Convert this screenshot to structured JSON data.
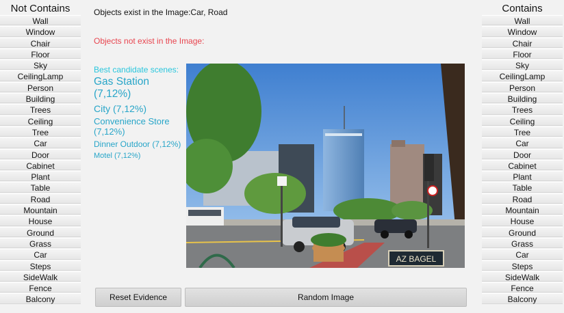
{
  "left_panel": {
    "title": "Not Contains",
    "items": [
      "Wall",
      "Window",
      "Chair",
      "Floor",
      "Sky",
      "CeilingLamp",
      "Person",
      "Building",
      "Trees",
      "Ceiling",
      "Tree",
      "Car",
      "Door",
      "Cabinet",
      "Plant",
      "Table",
      "Road",
      "Mountain",
      "House",
      "Ground",
      "Grass",
      "Car",
      "Steps",
      "SideWalk",
      "Fence",
      "Balcony"
    ]
  },
  "right_panel": {
    "title": "Contains",
    "items": [
      "Wall",
      "Window",
      "Chair",
      "Floor",
      "Sky",
      "CeilingLamp",
      "Person",
      "Building",
      "Trees",
      "Ceiling",
      "Tree",
      "Car",
      "Door",
      "Cabinet",
      "Plant",
      "Table",
      "Road",
      "Mountain",
      "House",
      "Ground",
      "Grass",
      "Car",
      "Steps",
      "SideWalk",
      "Fence",
      "Balcony"
    ]
  },
  "status": {
    "exist": "Objects exist in the Image:Car, Road",
    "not_exist": "Objects not exist in the Image:"
  },
  "scenes": {
    "heading": "Best candidate scenes:",
    "items": [
      "Gas Station (7,12%)",
      "City (7,12%)",
      "Convenience Store (7,12%)",
      "Dinner Outdoor (7,12%)",
      "Motel  (7,12%)"
    ]
  },
  "image": {
    "sign_text": "AZ BAGEL"
  },
  "buttons": {
    "reset": "Reset Evidence",
    "random": "Random Image"
  }
}
